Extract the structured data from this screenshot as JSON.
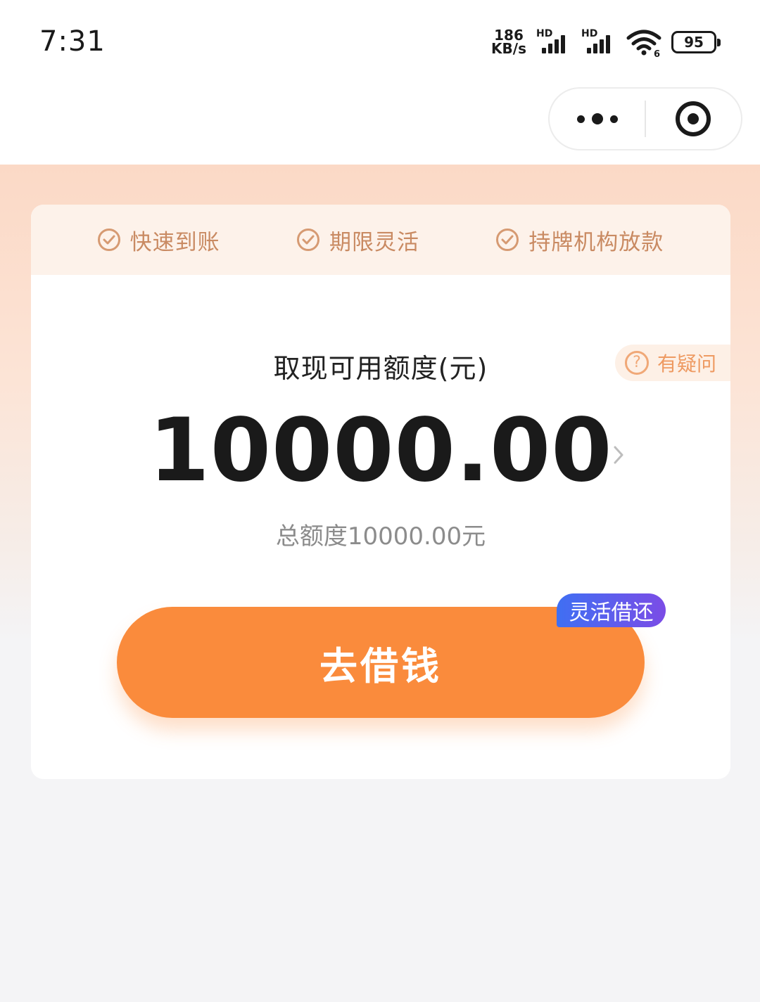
{
  "status_bar": {
    "time": "7:31",
    "net_speed_value": "186",
    "net_speed_unit": "KB/s",
    "sim1_label": "HD",
    "sim2_label": "HD",
    "wifi_badge": "6",
    "battery": "95"
  },
  "features": [
    {
      "label": "快速到账"
    },
    {
      "label": "期限灵活"
    },
    {
      "label": "持牌机构放款"
    }
  ],
  "help": {
    "label": "有疑问",
    "icon_glyph": "?"
  },
  "quota": {
    "label": "取现可用额度(元)",
    "amount": "10000.00",
    "total": "总额度10000.00元"
  },
  "borrow": {
    "button_label": "去借钱",
    "tag": "灵活借还"
  },
  "colors": {
    "accent_orange": "#fa8b3c",
    "feature_text": "#c98a62",
    "tag_gradient_start": "#3f6ff3",
    "tag_gradient_end": "#7b4ce6"
  },
  "icons": {
    "more": "more-dots-icon",
    "close_miniprogram": "target-circle-icon",
    "feature": "check-circle-icon",
    "help": "question-circle-icon",
    "arrow": "chevron-right-icon"
  }
}
